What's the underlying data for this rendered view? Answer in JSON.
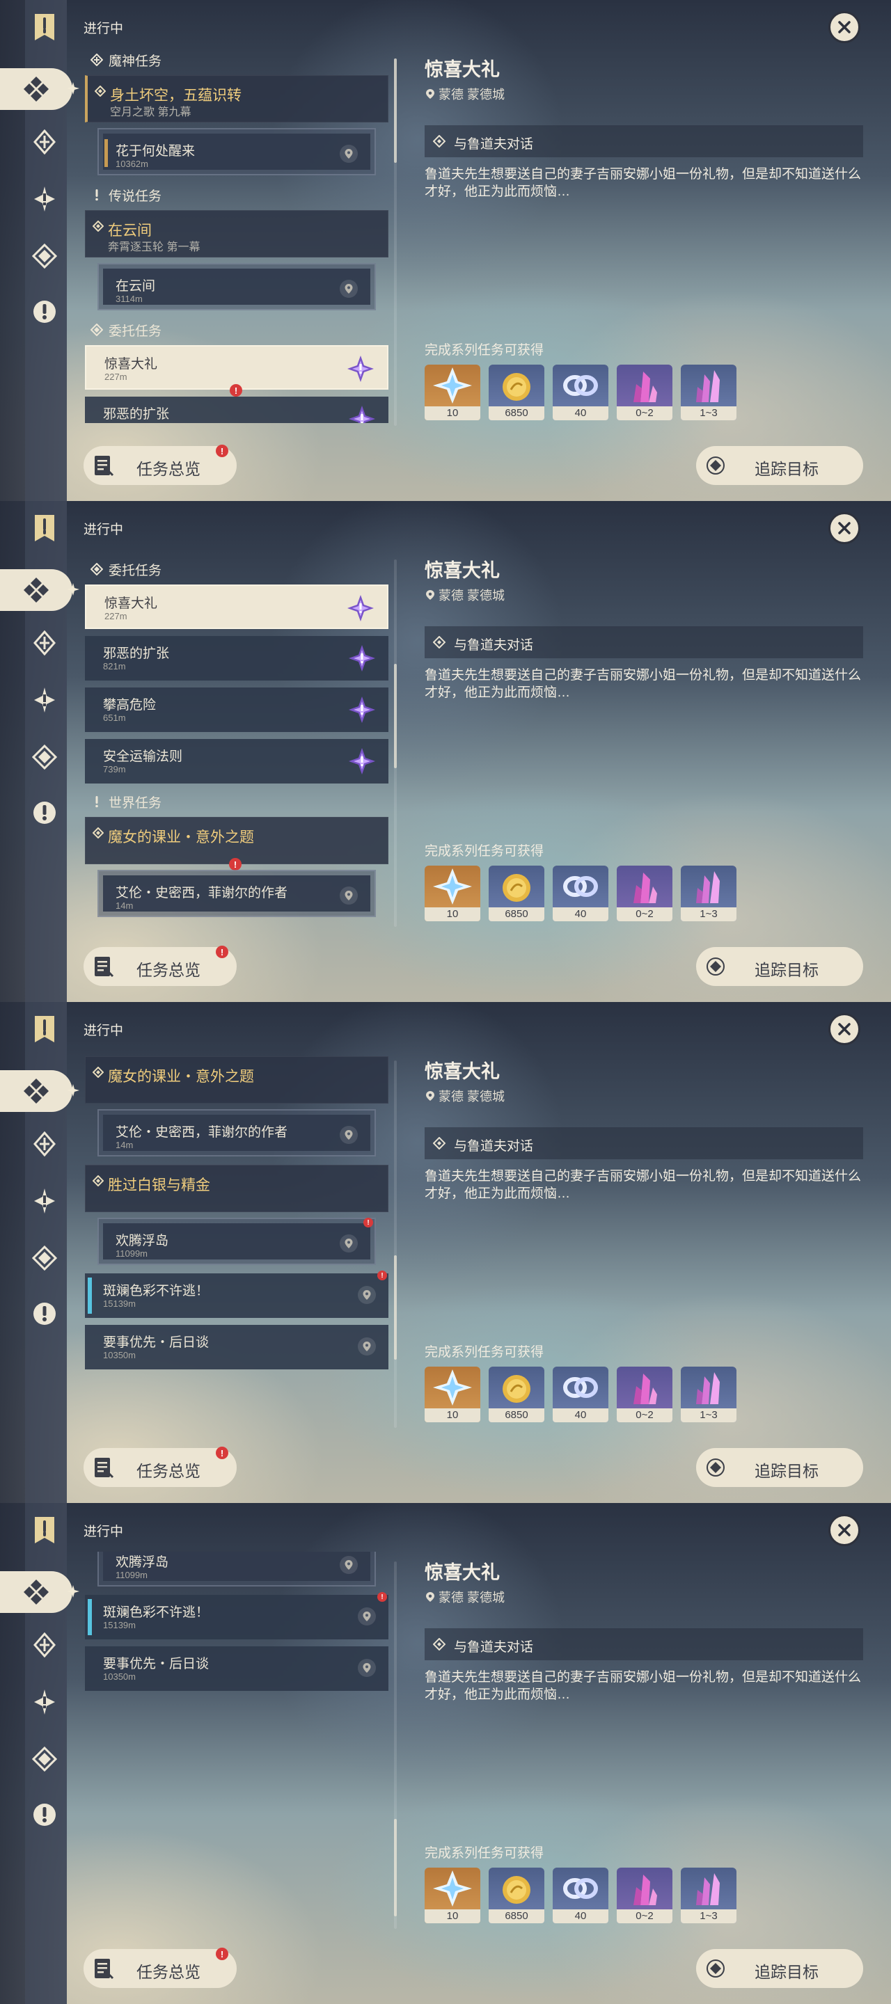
{
  "common": {
    "status": "进行中",
    "detail_title": "惊喜大礼",
    "detail_location": "蒙德 蒙德城",
    "detail_objective": "与鲁道夫对话",
    "detail_description": "鲁道夫先生想要送自己的妻子吉丽安娜小姐一份礼物，但是却不知道送什么才好，他正为此而烦恼…",
    "rewards_label": "完成系列任务可获得",
    "rewards": [
      {
        "icon": "primogem-icon",
        "count": "10"
      },
      {
        "icon": "mora-icon",
        "count": "6850"
      },
      {
        "icon": "companionship-exp-icon",
        "count": "40"
      },
      {
        "icon": "crystal-chunk-icon",
        "count": "0~2"
      },
      {
        "icon": "crystal-cluster-icon",
        "count": "1~3"
      }
    ],
    "overview_label": "任务总览",
    "track_label": "追踪目标",
    "alert_mark": "!"
  },
  "quests": {
    "archon_header": "魔神任务",
    "archon_title": "身土坏空，五蕴识转",
    "archon_subtitle": "空月之歌 第九幕",
    "archon_step_title": "花于何处醒来",
    "archon_step_distance": "10362m",
    "legend_header": "传说任务",
    "legend_title": "在云间",
    "legend_subtitle": "奔霄逐玉轮 第一幕",
    "legend_step_title": "在云间",
    "legend_step_distance": "3114m",
    "commission_header": "委托任务",
    "c1_title": "惊喜大礼",
    "c1_distance": "227m",
    "c2_title": "邪恶的扩张",
    "c2_distance": "821m",
    "c3_title": "攀高危险",
    "c3_distance": "651m",
    "c4_title": "安全运输法则",
    "c4_distance": "739m",
    "world_header": "世界任务",
    "w1_title": "魔女的课业・意外之题",
    "w1_step_title": "艾伦・史密西，菲谢尔的作者",
    "w1_step_distance": "14m",
    "w2_title": "胜过白银与精金",
    "w2_step_title": "欢腾浮岛",
    "w2_step_distance": "11099m",
    "w3_title": "斑斓色彩不许逃！",
    "w3_distance": "15139m",
    "w4_title": "要事优先・后日谈",
    "w4_distance": "10350m"
  }
}
